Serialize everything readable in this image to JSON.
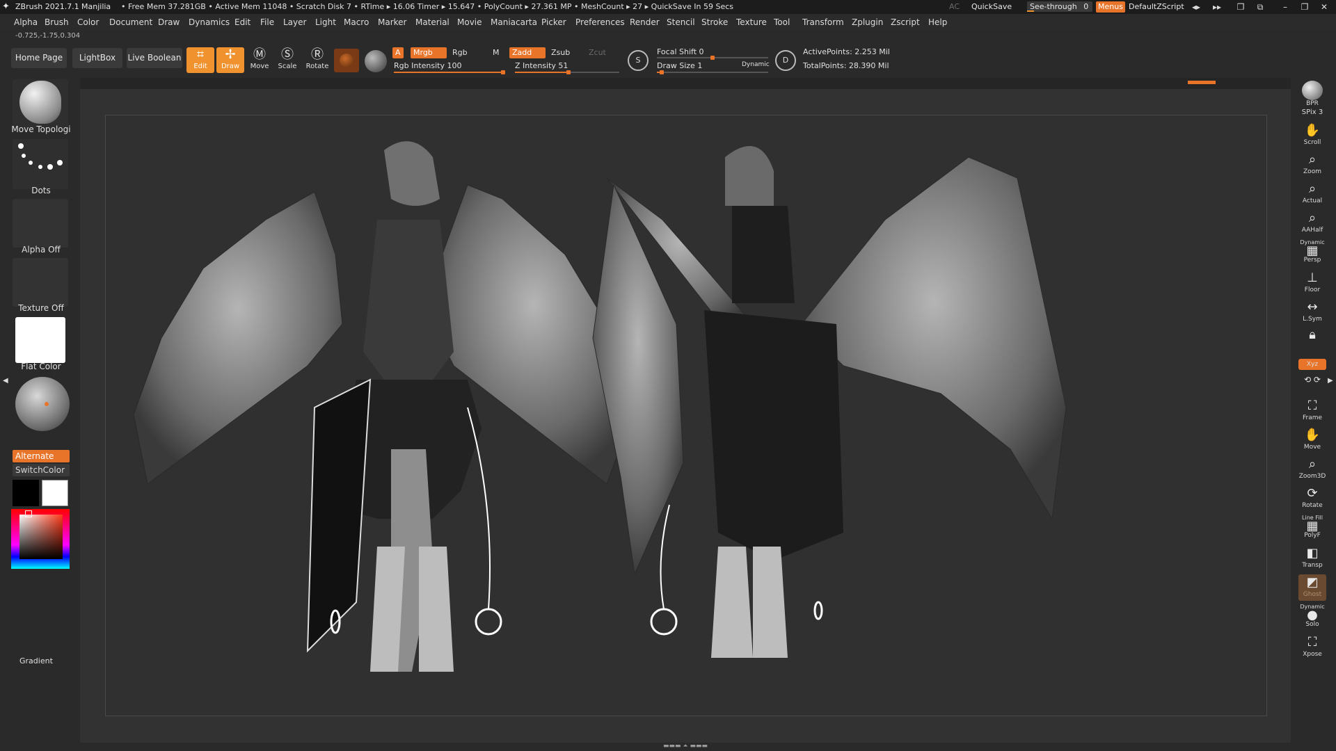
{
  "titlebar": {
    "app_title": "ZBrush 2021.7.1",
    "project": "Manjilia",
    "stats": "• Free Mem 37.281GB • Active Mem 11048 • Scratch Disk 7 • RTime ▸ 16.06 Timer ▸ 15.647 • PolyCount ▸ 27.361 MP • MeshCount ▸ 27 ▸ QuickSave In 59 Secs",
    "ac": "AC",
    "quicksave": "QuickSave",
    "see_through_label": "See-through",
    "see_through_value": "0",
    "menus": "Menus",
    "default_zscript": "DefaultZScript"
  },
  "menubar": [
    "Alpha",
    "Brush",
    "Color",
    "Document",
    "Draw",
    "Dynamics",
    "Edit",
    "File",
    "Layer",
    "Light",
    "Macro",
    "Marker",
    "Material",
    "Movie",
    "Maniacarta",
    "Picker",
    "Preferences",
    "Render",
    "Stencil",
    "Stroke",
    "Texture",
    "Tool",
    "Transform",
    "Zplugin",
    "Zscript",
    "Help"
  ],
  "coords": "-0.725,-1.75,0.304",
  "shelf": {
    "home_page": "Home Page",
    "lightbox": "LightBox",
    "live_boolean": "Live Boolean",
    "tools": [
      {
        "label": "Edit",
        "icon": "edit-icon",
        "active": true
      },
      {
        "label": "Draw",
        "icon": "draw-icon",
        "active": true
      },
      {
        "label": "Move",
        "icon": "move-icon",
        "active": false
      },
      {
        "label": "Scale",
        "icon": "scale-icon",
        "active": false
      },
      {
        "label": "Rotate",
        "icon": "rotate-icon",
        "active": false
      }
    ],
    "a_label": "A",
    "mrgb": "Mrgb",
    "rgb": "Rgb",
    "m": "M",
    "zadd": "Zadd",
    "zsub": "Zsub",
    "zcut": "Zcut",
    "rgb_intensity_label": "Rgb Intensity",
    "rgb_intensity": "100",
    "z_intensity_label": "Z Intensity",
    "z_intensity": "51",
    "focal_shift_label": "Focal Shift",
    "focal_shift": "0",
    "draw_size_label": "Draw Size",
    "draw_size": "1",
    "dynamic": "Dynamic",
    "active_points": "ActivePoints: 2.253 Mil",
    "total_points": "TotalPoints: 28.390 Mil"
  },
  "lefttray": {
    "brush": "Move Topologi",
    "stroke": "Dots",
    "alpha": "Alpha Off",
    "texture": "Texture Off",
    "material": "Flat Color",
    "alternate": "Alternate",
    "switch_color": "SwitchColor",
    "gradient": "Gradient"
  },
  "righttray": [
    {
      "label": "BPR",
      "sub": "SPix 3"
    },
    {
      "label": "Scroll"
    },
    {
      "label": "Zoom"
    },
    {
      "label": "Actual"
    },
    {
      "label": "AAHalf"
    },
    {
      "label": "Persp",
      "top": "Dynamic"
    },
    {
      "label": "Floor"
    },
    {
      "label": "L.Sym"
    },
    {
      "label": ""
    },
    {
      "label": "Xyz"
    },
    {
      "label": "Frame"
    },
    {
      "label": "Move"
    },
    {
      "label": "Zoom3D"
    },
    {
      "label": "Rotate"
    },
    {
      "label": "PolyF",
      "top": "Line Fill"
    },
    {
      "label": "Transp"
    },
    {
      "label": "Ghost"
    },
    {
      "label": "Solo",
      "top": "Dynamic"
    },
    {
      "label": "Xpose"
    }
  ],
  "colors": {
    "accent": "#e8742a",
    "panel": "#2b2b2b",
    "viewport": "#323232"
  }
}
